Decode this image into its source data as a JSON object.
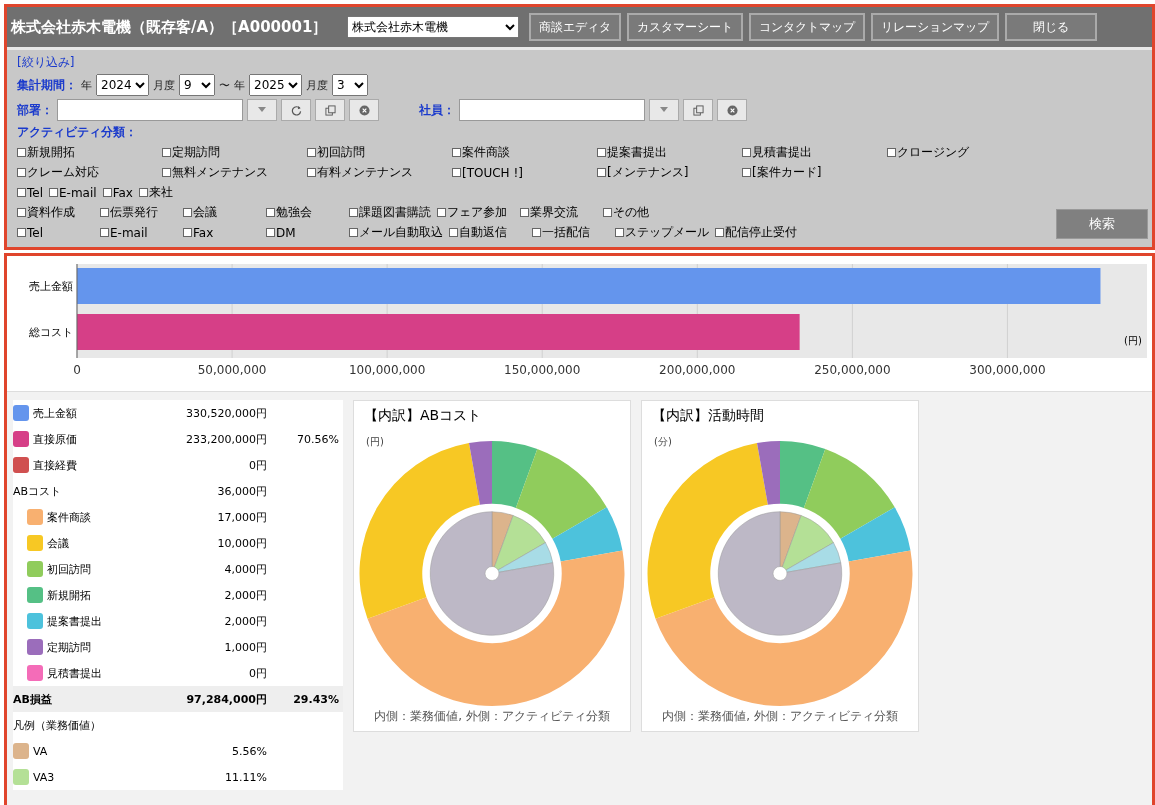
{
  "header": {
    "title": "株式会社赤木電機（既存客/A）［A000001］",
    "company_select": "株式会社赤木電機",
    "buttons": [
      "商談エディタ",
      "カスタマーシート",
      "コンタクトマップ",
      "リレーションマップ",
      "閉じる"
    ]
  },
  "filter": {
    "title": "[絞り込み]",
    "period": {
      "label": "集計期間：",
      "from_year_label": "年",
      "from_month_label": "月度",
      "range_sep": "〜",
      "to_year_label": "年",
      "to_month_label": "月度",
      "from_year": "2024",
      "from_month": "9",
      "to_year": "2025",
      "to_month": "3"
    },
    "department": {
      "label": "部署："
    },
    "employee": {
      "label": "社員："
    },
    "activity_title": "アクティビティ分類：",
    "activity_rows": [
      [
        {
          "label": "新規開拓",
          "checked": false
        },
        {
          "label": "定期訪問",
          "checked": false
        },
        {
          "label": "初回訪問",
          "checked": false
        },
        {
          "label": "案件商談",
          "checked": false
        },
        {
          "label": "提案書提出",
          "checked": false
        },
        {
          "label": "見積書提出",
          "checked": false
        },
        {
          "label": "クロージング",
          "checked": false
        }
      ],
      [
        {
          "label": "クレーム対応",
          "checked": false
        },
        {
          "label": "無料メンテナンス",
          "checked": false
        },
        {
          "label": "有料メンテナンス",
          "checked": false
        },
        {
          "label": "[TOUCH !]",
          "checked": false
        },
        {
          "label": "[メンテナンス]",
          "checked": false
        },
        {
          "label": "[案件カード]",
          "checked": false
        }
      ],
      [
        {
          "label": "Tel",
          "checked": false
        },
        {
          "label": "E-mail",
          "checked": false
        },
        {
          "label": "Fax",
          "checked": false
        },
        {
          "label": "来社",
          "checked": false
        }
      ],
      [
        {
          "label": "資料作成",
          "checked": false
        },
        {
          "label": "伝票発行",
          "checked": false
        },
        {
          "label": "会議",
          "checked": false
        },
        {
          "label": "勉強会",
          "checked": false
        },
        {
          "label": "課題図書購読",
          "checked": false
        },
        {
          "label": "フェア参加",
          "checked": false
        },
        {
          "label": "業界交流",
          "checked": false
        },
        {
          "label": "その他",
          "checked": false
        }
      ],
      [
        {
          "label": "Tel",
          "checked": false
        },
        {
          "label": "E-mail",
          "checked": false
        },
        {
          "label": "Fax",
          "checked": false
        },
        {
          "label": "DM",
          "checked": false
        },
        {
          "label": "メール自動取込",
          "checked": false
        },
        {
          "label": "自動返信",
          "checked": false
        },
        {
          "label": "一括配信",
          "checked": false
        },
        {
          "label": "ステップメール",
          "checked": false
        },
        {
          "label": "配信停止受付",
          "checked": false
        }
      ]
    ],
    "search_button": "検索"
  },
  "bar_chart": {
    "unit": "(円)",
    "chart_data": {
      "type": "bar",
      "orientation": "horizontal",
      "categories": [
        "売上金額",
        "総コスト"
      ],
      "series": [
        {
          "color": "#6495ed",
          "values": [
            330000000,
            null
          ]
        },
        {
          "color": "#d63f87",
          "values": [
            null,
            233000000
          ]
        }
      ],
      "grid": true,
      "xlim": [
        0,
        345000000
      ],
      "xticks": [
        {
          "value": 0,
          "label": "0"
        },
        {
          "value": 50000000,
          "label": "50,000,000"
        },
        {
          "value": 100000000,
          "label": "100,000,000"
        },
        {
          "value": 150000000,
          "label": "150,000,000"
        },
        {
          "value": 200000000,
          "label": "200,000,000"
        },
        {
          "value": 250000000,
          "label": "250,000,000"
        },
        {
          "value": 300000000,
          "label": "300,000,000"
        }
      ]
    }
  },
  "summary": {
    "rows": [
      {
        "label": "売上金額",
        "value": "330,520,000円",
        "color": "#6495ed"
      },
      {
        "label": "直接原価",
        "value": "233,200,000円",
        "percent": "70.56%",
        "color": "#d63f87"
      },
      {
        "label": "直接経費",
        "value": "0円",
        "color": "#d05050"
      },
      {
        "label": "ABコスト",
        "value": "36,000円",
        "children": [
          {
            "label": "案件商談",
            "value": "17,000円",
            "color": "#f8b070"
          },
          {
            "label": "会議",
            "value": "10,000円",
            "color": "#f7c824"
          },
          {
            "label": "初回訪問",
            "value": "4,000円",
            "color": "#90cc5c"
          },
          {
            "label": "新規開拓",
            "value": "2,000円",
            "color": "#55c085"
          },
          {
            "label": "提案書提出",
            "value": "2,000円",
            "color": "#4dc2dc"
          },
          {
            "label": "定期訪問",
            "value": "1,000円",
            "color": "#9b6dbb"
          },
          {
            "label": "見積書提出",
            "value": "0円",
            "color": "#f46cb8"
          }
        ]
      }
    ],
    "total": {
      "label": "AB損益",
      "value": "97,284,000円",
      "percent": "29.43%"
    },
    "legend_title": "凡例（業務価値）",
    "legend": [
      {
        "label": "VA",
        "value": "5.56%",
        "color": "#dcb48c"
      },
      {
        "label": "VA3",
        "value": "11.11%",
        "color": "#b4e096"
      }
    ]
  },
  "donuts": [
    {
      "title": "【内訳】ABコスト",
      "unit": "(円)",
      "caption": "内側：業務価値, 外側：アクティビティ分類"
    },
    {
      "title": "【内訳】活動時間",
      "unit": "(分)",
      "caption": "内側：業務価値, 外側：アクティビティ分類"
    }
  ]
}
